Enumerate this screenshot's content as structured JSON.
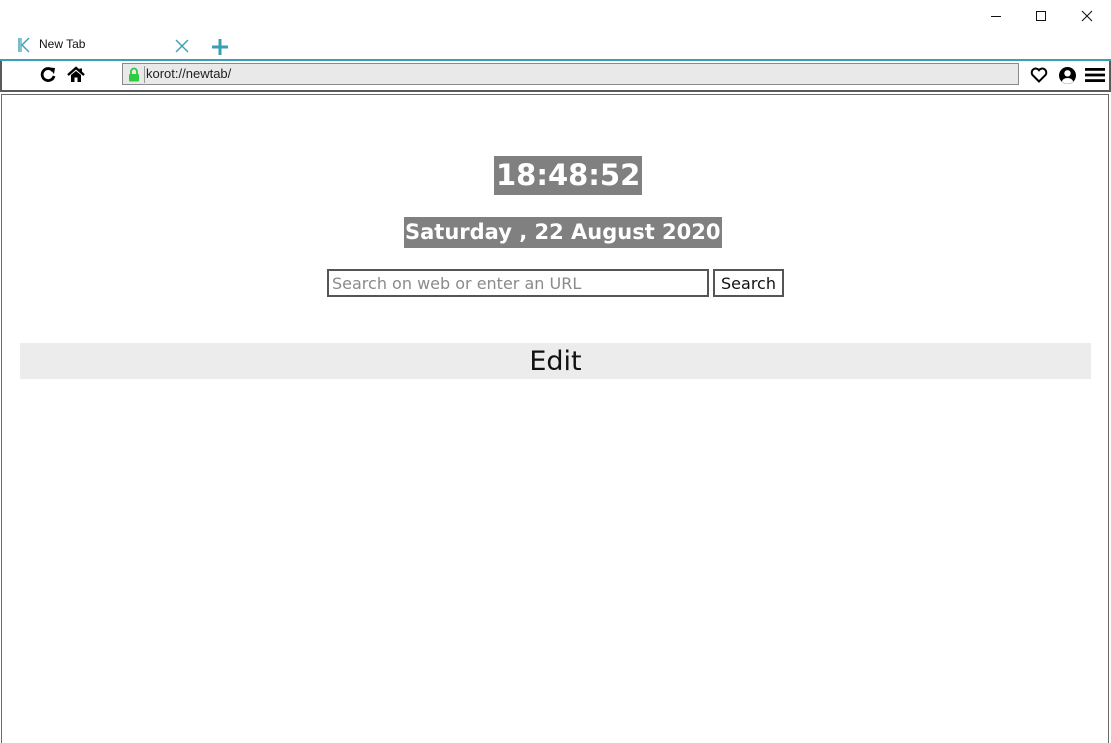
{
  "window": {
    "controls": {
      "minimize": "minimize",
      "maximize": "maximize",
      "close": "close"
    }
  },
  "tabs": [
    {
      "title": "New Tab",
      "icon": "korot-logo-icon",
      "active": true
    }
  ],
  "toolbar": {
    "icons": [
      "reload-icon",
      "home-icon",
      "heart-icon",
      "profile-icon",
      "menu-icon"
    ],
    "url": "korot://newtab/",
    "secure": true
  },
  "newtab": {
    "time": "18:48:52",
    "date": "Saturday , 22 August 2020",
    "search": {
      "placeholder": "Search on web or enter an URL",
      "value": "",
      "button_label": "Search"
    },
    "edit_label": "Edit"
  },
  "colors": {
    "accent": "#3a9fb6",
    "lock_green": "#2ecc40",
    "clock_bg": "#808080",
    "edit_bg": "#ececec"
  }
}
